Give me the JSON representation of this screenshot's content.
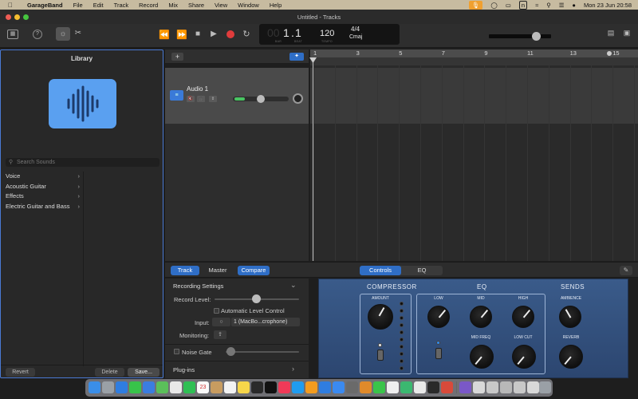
{
  "menubar": {
    "app": "GarageBand",
    "items": [
      "File",
      "Edit",
      "Track",
      "Record",
      "Mix",
      "Share",
      "View",
      "Window",
      "Help"
    ],
    "input_badge": "n",
    "clock": "Mon 23 Jun  20:58"
  },
  "window": {
    "title": "Untitled - Tracks"
  },
  "lcd": {
    "bar": "1",
    "beat": "1",
    "bar_label": "BAR",
    "beat_label": "BEAT",
    "tempo": "120",
    "tempo_label": "TEMPO",
    "signature": "4/4",
    "key": "Cmaj"
  },
  "toolbar": {
    "count_in": "1234",
    "master_volume": 0.75
  },
  "library": {
    "title": "Library",
    "search_placeholder": "Search Sounds",
    "categories": [
      "Voice",
      "Acoustic Guitar",
      "Effects",
      "Electric Guitar and Bass"
    ],
    "revert": "Revert",
    "delete": "Delete",
    "save": "Save..."
  },
  "tracks": [
    {
      "name": "Audio 1",
      "volume": 0.5
    }
  ],
  "ruler": {
    "labels": [
      "1",
      "3",
      "5",
      "7",
      "9",
      "11",
      "13",
      "15"
    ]
  },
  "smart_controls": {
    "left_tabs": [
      "Track",
      "Master",
      "Compare"
    ],
    "right_tabs": [
      "Controls",
      "EQ"
    ],
    "recording_settings": "Recording Settings",
    "record_level": "Record Level:",
    "auto_level": "Automatic Level Control",
    "input_label": "Input:",
    "input_value": "1 (MacBo...crophone)",
    "monitoring": "Monitoring:",
    "noise_gate": "Noise Gate",
    "plugins": "Plug-ins"
  },
  "plugin": {
    "compressor": "COMPRESSOR",
    "amount": "AMOUNT",
    "eq": "EQ",
    "low": "LOW",
    "mid": "MID",
    "high": "HIGH",
    "mid_freq": "MID FREQ",
    "low_cut": "LOW CUT",
    "sends": "SENDS",
    "ambience": "AMBIENCE",
    "reverb": "REVERB"
  },
  "dock": {
    "calendar_day": "23"
  },
  "colors": {
    "accent": "#2f6ec6",
    "count_in": "#7a49c8",
    "library_art": "#5aa0f0",
    "record": "#e03c3c"
  }
}
